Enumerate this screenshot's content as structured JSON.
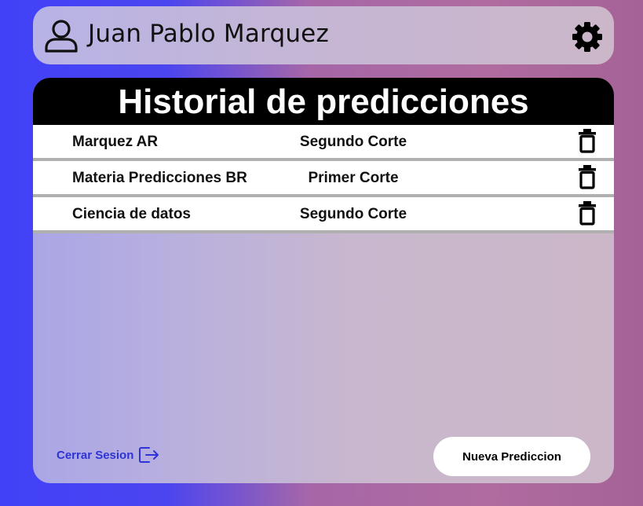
{
  "header": {
    "user_name": "Juan Pablo Marquez",
    "user_icon": "user-icon",
    "settings_icon": "gear-icon"
  },
  "history": {
    "title": "Historial de predicciones",
    "rows": [
      {
        "name": "Marquez AR",
        "period": "Segundo Corte",
        "delete_icon": "trash-icon"
      },
      {
        "name": "Materia Predicciones BR",
        "period": "Primer Corte",
        "delete_icon": "trash-icon"
      },
      {
        "name": "Ciencia de datos",
        "period": "Segundo Corte",
        "delete_icon": "trash-icon"
      }
    ]
  },
  "footer": {
    "logout_label": "Cerrar Sesion",
    "logout_icon": "logout-icon",
    "new_prediction_label": "Nueva Prediccion"
  },
  "colors": {
    "background_left": "#4141f8",
    "background_right": "#a56296",
    "title_bar": "#000000",
    "logout_text": "#2d33d6",
    "row_divider": "#b0b0b0"
  }
}
